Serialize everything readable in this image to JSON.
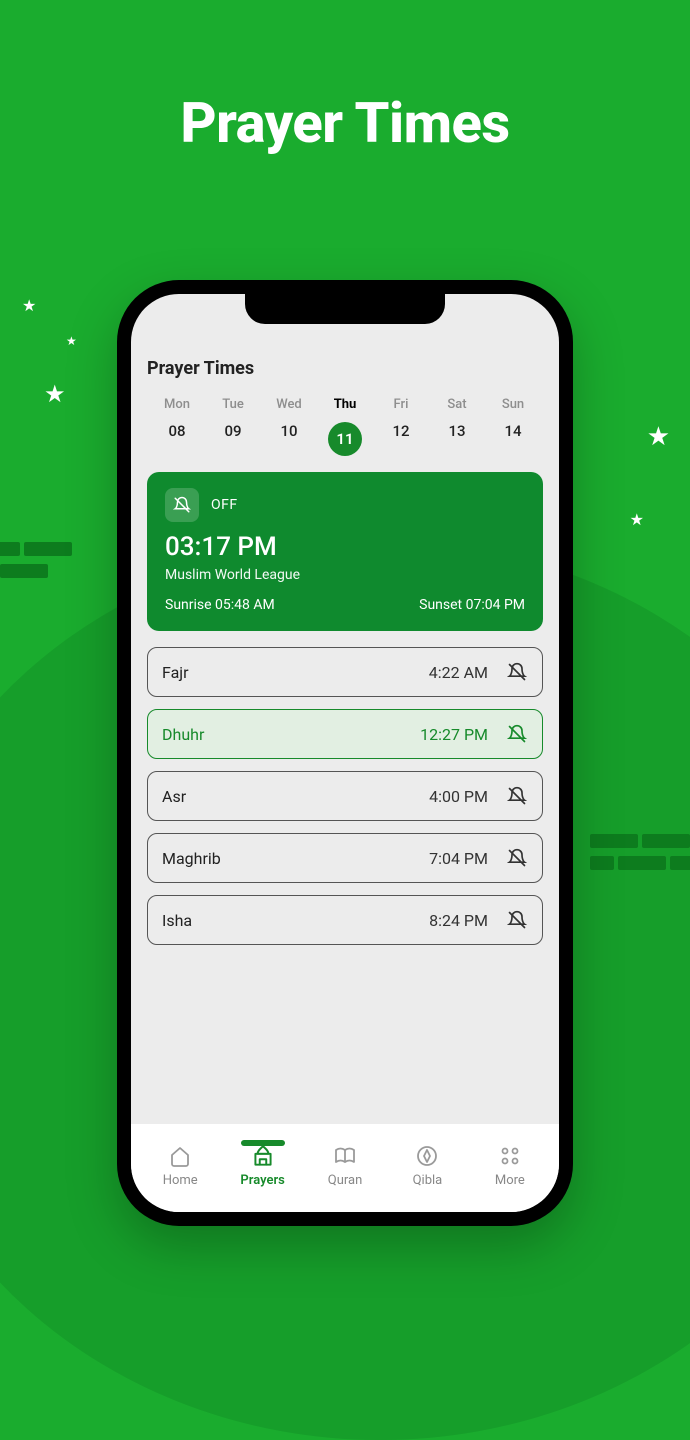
{
  "promo": {
    "title": "Prayer Times"
  },
  "header": {
    "title": "Prayer Times"
  },
  "days": [
    {
      "dow": "Mon",
      "num": "08",
      "active": false
    },
    {
      "dow": "Tue",
      "num": "09",
      "active": false
    },
    {
      "dow": "Wed",
      "num": "10",
      "active": false
    },
    {
      "dow": "Thu",
      "num": "11",
      "active": true
    },
    {
      "dow": "Fri",
      "num": "12",
      "active": false
    },
    {
      "dow": "Sat",
      "num": "13",
      "active": false
    },
    {
      "dow": "Sun",
      "num": "14",
      "active": false
    }
  ],
  "hero": {
    "alarm_state": "OFF",
    "time": "03:17 PM",
    "method": "Muslim World League",
    "sunrise": "Sunrise 05:48 AM",
    "sunset": "Sunset 07:04 PM"
  },
  "prayers": [
    {
      "name": "Fajr",
      "time": "4:22 AM",
      "active": false
    },
    {
      "name": "Dhuhr",
      "time": "12:27 PM",
      "active": true
    },
    {
      "name": "Asr",
      "time": "4:00 PM",
      "active": false
    },
    {
      "name": "Maghrib",
      "time": "7:04 PM",
      "active": false
    },
    {
      "name": "Isha",
      "time": "8:24 PM",
      "active": false
    }
  ],
  "nav": [
    {
      "label": "Home",
      "active": false,
      "icon": "home-icon"
    },
    {
      "label": "Prayers",
      "active": true,
      "icon": "mosque-icon"
    },
    {
      "label": "Quran",
      "active": false,
      "icon": "quran-icon"
    },
    {
      "label": "Qibla",
      "active": false,
      "icon": "qibla-icon"
    },
    {
      "label": "More",
      "active": false,
      "icon": "more-icon"
    }
  ]
}
